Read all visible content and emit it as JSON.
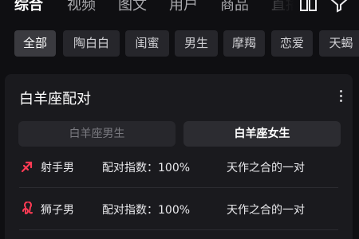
{
  "top_tabs": [
    "综合",
    "视频",
    "图文",
    "用户",
    "商品",
    "直播"
  ],
  "chips": [
    "全部",
    "陶白白",
    "闺蜜",
    "男生",
    "摩羯",
    "恋爱",
    "天蝎"
  ],
  "card": {
    "title": "白羊座配对",
    "segments": [
      "白羊座男生",
      "白羊座女生"
    ],
    "rows": [
      {
        "sign": "射手男",
        "label": "配对指数：100%",
        "desc": "天作之合的一对",
        "icon": "sagittarius-icon"
      },
      {
        "sign": "狮子男",
        "label": "配对指数：100%",
        "desc": "天作之合的一对",
        "icon": "leo-icon"
      }
    ]
  },
  "colors": {
    "accent": "#ff3b54",
    "background": "#0f0f12",
    "card": "#1a1a1e"
  },
  "icons": [
    "column-view-icon",
    "filter-icon",
    "more-vertical-icon"
  ]
}
